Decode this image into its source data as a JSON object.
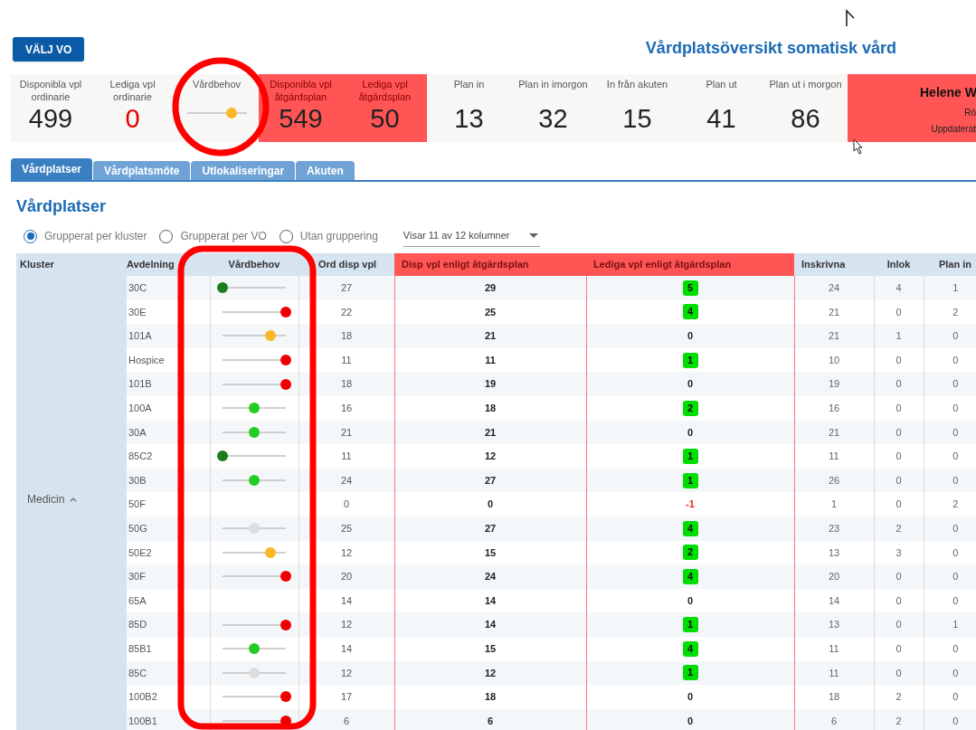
{
  "header": {
    "button": "VÄLJ VO",
    "title": "Vårdplatsöversikt somatisk vård"
  },
  "summary": [
    {
      "kind": "stat",
      "label": "Disponibla vpl ordinarie",
      "value": "499",
      "alert": false,
      "highlight": false
    },
    {
      "kind": "stat",
      "label": "Lediga vpl ordinarie",
      "value": "0",
      "alert": true,
      "highlight": false
    },
    {
      "kind": "slider",
      "label": "Vårdbehov",
      "level": 0.75,
      "color": "#fbb826",
      "highlight": false
    },
    {
      "kind": "stat",
      "label": "Disponibla vpl åtgärdsplan",
      "value": "549",
      "alert": false,
      "highlight": true
    },
    {
      "kind": "stat",
      "label": "Lediga vpl åtgärdsplan",
      "value": "50",
      "alert": false,
      "highlight": true
    },
    {
      "kind": "stat",
      "label": "Plan in",
      "value": "13",
      "alert": false,
      "highlight": false
    },
    {
      "kind": "stat",
      "label": "Plan in imorgon",
      "value": "32",
      "alert": false,
      "highlight": false
    },
    {
      "kind": "stat",
      "label": "In från akuten",
      "value": "15",
      "alert": false,
      "highlight": false
    },
    {
      "kind": "stat",
      "label": "Plan ut",
      "value": "41",
      "alert": false,
      "highlight": false
    },
    {
      "kind": "stat",
      "label": "Plan ut i morgon",
      "value": "86",
      "alert": false,
      "highlight": false
    }
  ],
  "notice": {
    "name": "Helene W",
    "line_2": "Rö",
    "line_3": "Uppdaterat"
  },
  "tabs": [
    {
      "label": "Vårdplatser",
      "selected": true
    },
    {
      "label": "Vårdplatsmöte",
      "selected": false
    },
    {
      "label": "Utlokaliseringar",
      "selected": false
    },
    {
      "label": "Akuten",
      "selected": false
    }
  ],
  "section_title": "Vårdplatser",
  "grouping": [
    {
      "label": "Grupperat per kluster",
      "selected": true
    },
    {
      "label": "Grupperat per VO",
      "selected": false
    },
    {
      "label": "Utan gruppering",
      "selected": false
    }
  ],
  "column_picker": "Visar 11 av 12 kolumner",
  "table": {
    "columns": [
      {
        "label": "Kluster",
        "highlight": false
      },
      {
        "label": "Avdelning",
        "highlight": false
      },
      {
        "label": "Vårdbehov",
        "highlight": false
      },
      {
        "label": "Ord disp vpl",
        "highlight": false
      },
      {
        "label": "Disp vpl enligt åtgärdsplan",
        "highlight": true
      },
      {
        "label": "Lediga vpl enligt åtgärdsplan",
        "highlight": true
      },
      {
        "label": "Inskrivna",
        "highlight": false
      },
      {
        "label": "Inlok",
        "highlight": false
      },
      {
        "label": "Plan in",
        "highlight": false
      }
    ],
    "groups": [
      {
        "name": "Medicin",
        "expanded": true,
        "rows": [
          {
            "avdelning": "30C",
            "vardbehov": {
              "level": 0,
              "color": "#1a7f1a"
            },
            "ord_disp": "27",
            "disp_atgard": "29",
            "lediga": {
              "value": "5",
              "kind": "badge"
            },
            "inskrivna": "24",
            "inlok": "4",
            "plan_in": "1"
          },
          {
            "avdelning": "30E",
            "vardbehov": {
              "level": 1,
              "color": "#ee0000"
            },
            "ord_disp": "22",
            "disp_atgard": "25",
            "lediga": {
              "value": "4",
              "kind": "badge"
            },
            "inskrivna": "21",
            "inlok": "0",
            "plan_in": "2"
          },
          {
            "avdelning": "101A",
            "vardbehov": {
              "level": 0.75,
              "color": "#fbb826"
            },
            "ord_disp": "18",
            "disp_atgard": "21",
            "lediga": {
              "value": "0",
              "kind": "plain"
            },
            "inskrivna": "21",
            "inlok": "1",
            "plan_in": "0"
          },
          {
            "avdelning": "Hospice",
            "vardbehov": {
              "level": 1,
              "color": "#ee0000"
            },
            "ord_disp": "11",
            "disp_atgard": "11",
            "lediga": {
              "value": "1",
              "kind": "badge"
            },
            "inskrivna": "10",
            "inlok": "0",
            "plan_in": "0"
          },
          {
            "avdelning": "101B",
            "vardbehov": {
              "level": 1,
              "color": "#ee0000"
            },
            "ord_disp": "18",
            "disp_atgard": "19",
            "lediga": {
              "value": "0",
              "kind": "plain"
            },
            "inskrivna": "19",
            "inlok": "0",
            "plan_in": "0"
          },
          {
            "avdelning": "100A",
            "vardbehov": {
              "level": 0.5,
              "color": "#22cc22"
            },
            "ord_disp": "16",
            "disp_atgard": "18",
            "lediga": {
              "value": "2",
              "kind": "badge"
            },
            "inskrivna": "16",
            "inlok": "0",
            "plan_in": "0"
          },
          {
            "avdelning": "30A",
            "vardbehov": {
              "level": 0.5,
              "color": "#22cc22"
            },
            "ord_disp": "21",
            "disp_atgard": "21",
            "lediga": {
              "value": "0",
              "kind": "plain"
            },
            "inskrivna": "21",
            "inlok": "0",
            "plan_in": "0"
          },
          {
            "avdelning": "85C2",
            "vardbehov": {
              "level": 0,
              "color": "#1a7f1a"
            },
            "ord_disp": "11",
            "disp_atgard": "12",
            "lediga": {
              "value": "1",
              "kind": "badge"
            },
            "inskrivna": "11",
            "inlok": "0",
            "plan_in": "0"
          },
          {
            "avdelning": "30B",
            "vardbehov": {
              "level": 0.5,
              "color": "#22cc22"
            },
            "ord_disp": "24",
            "disp_atgard": "27",
            "lediga": {
              "value": "1",
              "kind": "badge"
            },
            "inskrivna": "26",
            "inlok": "0",
            "plan_in": "0"
          },
          {
            "avdelning": "50F",
            "ord_disp": "0",
            "disp_atgard": "0",
            "lediga": {
              "value": "-1",
              "kind": "negative"
            },
            "inskrivna": "1",
            "inlok": "0",
            "plan_in": "2"
          },
          {
            "avdelning": "50G",
            "vardbehov": {
              "level": 0.5,
              "color": "#dddddd"
            },
            "ord_disp": "25",
            "disp_atgard": "27",
            "lediga": {
              "value": "4",
              "kind": "badge"
            },
            "inskrivna": "23",
            "inlok": "2",
            "plan_in": "0"
          },
          {
            "avdelning": "50E2",
            "vardbehov": {
              "level": 0.75,
              "color": "#fbb826"
            },
            "ord_disp": "12",
            "disp_atgard": "15",
            "lediga": {
              "value": "2",
              "kind": "badge"
            },
            "inskrivna": "13",
            "inlok": "3",
            "plan_in": "0"
          },
          {
            "avdelning": "30F",
            "vardbehov": {
              "level": 1,
              "color": "#ee0000"
            },
            "ord_disp": "20",
            "disp_atgard": "24",
            "lediga": {
              "value": "4",
              "kind": "badge"
            },
            "inskrivna": "20",
            "inlok": "0",
            "plan_in": "0"
          },
          {
            "avdelning": "65A",
            "ord_disp": "14",
            "disp_atgard": "14",
            "lediga": {
              "value": "0",
              "kind": "plain"
            },
            "inskrivna": "14",
            "inlok": "0",
            "plan_in": "0"
          },
          {
            "avdelning": "85D",
            "vardbehov": {
              "level": 1,
              "color": "#ee0000"
            },
            "ord_disp": "12",
            "disp_atgard": "14",
            "lediga": {
              "value": "1",
              "kind": "badge"
            },
            "inskrivna": "13",
            "inlok": "0",
            "plan_in": "1"
          },
          {
            "avdelning": "85B1",
            "vardbehov": {
              "level": 0.5,
              "color": "#22cc22"
            },
            "ord_disp": "14",
            "disp_atgard": "15",
            "lediga": {
              "value": "4",
              "kind": "badge"
            },
            "inskrivna": "11",
            "inlok": "0",
            "plan_in": "0"
          },
          {
            "avdelning": "85C",
            "vardbehov": {
              "level": 0.5,
              "color": "#dddddd"
            },
            "ord_disp": "12",
            "disp_atgard": "12",
            "lediga": {
              "value": "1",
              "kind": "badge"
            },
            "inskrivna": "11",
            "inlok": "0",
            "plan_in": "0"
          },
          {
            "avdelning": "100B2",
            "vardbehov": {
              "level": 1,
              "color": "#ee0000"
            },
            "ord_disp": "17",
            "disp_atgard": "18",
            "lediga": {
              "value": "0",
              "kind": "plain"
            },
            "inskrivna": "18",
            "inlok": "2",
            "plan_in": "0"
          },
          {
            "avdelning": "100B1",
            "vardbehov": {
              "level": 1,
              "color": "#ee0000"
            },
            "ord_disp": "6",
            "disp_atgard": "6",
            "lediga": {
              "value": "0",
              "kind": "plain"
            },
            "inskrivna": "6",
            "inlok": "2",
            "plan_in": "0"
          }
        ]
      }
    ]
  },
  "annotations": [
    {
      "kind": "circle"
    },
    {
      "kind": "frame"
    }
  ]
}
